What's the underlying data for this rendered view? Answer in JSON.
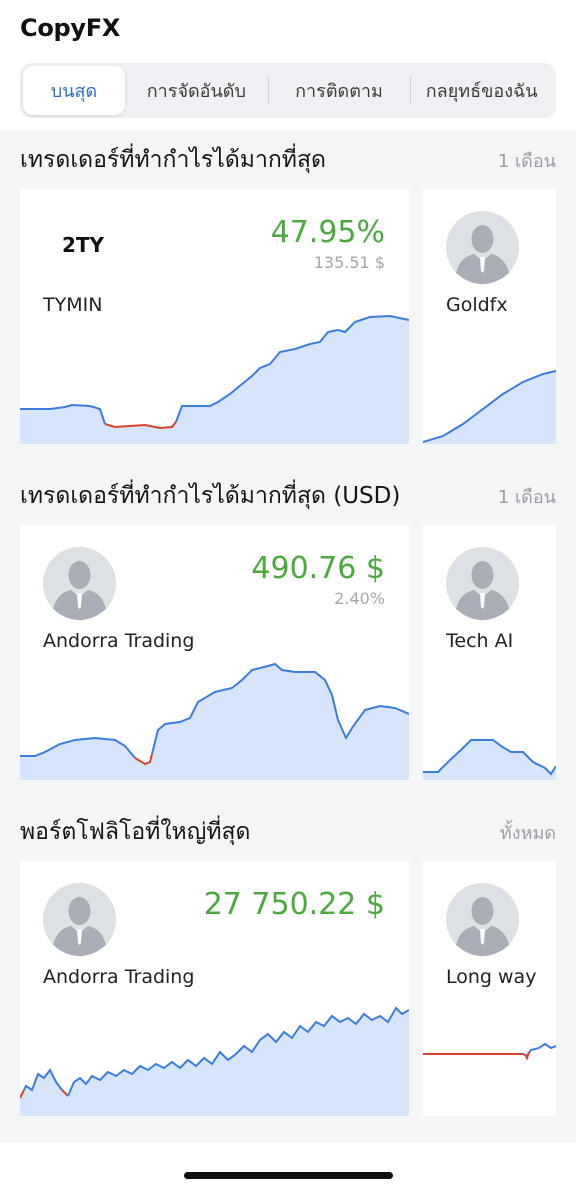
{
  "app": {
    "title": "CopyFX"
  },
  "tabs": [
    {
      "label": "บนสุด",
      "active": true
    },
    {
      "label": "การจัดอันดับ",
      "active": false
    },
    {
      "label": "การติดตาม",
      "active": false
    },
    {
      "label": "กลยุทธ์ของฉัน",
      "active": false
    }
  ],
  "colors": {
    "accent": "#2f6fd1",
    "positive": "#4aab3c",
    "negative": "#d9422c",
    "chart_line": "#3b7ddd",
    "chart_fill": "#cfe0fb"
  },
  "sections": [
    {
      "title": "เทรดเดอร์ที่ทำกำไรได้มากที่สุด",
      "link": "1 เดือน",
      "cards": [
        {
          "logo_text": "2TY",
          "name": "TYMIN",
          "metric": "47.95%",
          "submetric": "135.51 $",
          "avatar": "logo"
        },
        {
          "name": "Goldfx",
          "avatar": "person-icon"
        }
      ]
    },
    {
      "title": "เทรดเดอร์ที่ทำกำไรได้มากที่สุด (USD)",
      "link": "1 เดือน",
      "cards": [
        {
          "name": "Andorra Trading",
          "metric": "490.76 $",
          "submetric": "2.40%",
          "avatar": "person-icon"
        },
        {
          "name": "Tech AI",
          "avatar": "person-icon"
        }
      ]
    },
    {
      "title": "พอร์ตโฟลิโอที่ใหญ่ที่สุด",
      "link": "ทั้งหมด",
      "cards": [
        {
          "name": "Andorra Trading",
          "metric": "27 750.22 $",
          "avatar": "person-icon"
        },
        {
          "name": "Long way",
          "avatar": "person-icon"
        }
      ]
    }
  ]
}
